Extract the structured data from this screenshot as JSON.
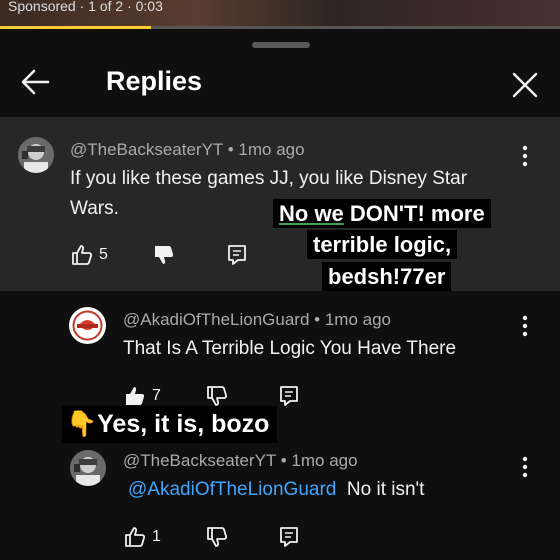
{
  "video": {
    "sponsor_text": "Sponsored · 1 of 2 · 0:03",
    "progress_fraction": 0.27,
    "progress_color": "#ffcc33"
  },
  "header": {
    "title": "Replies",
    "back_icon": "arrow-left-icon",
    "close_icon": "close-icon"
  },
  "parent_comment": {
    "author": "@TheBackseaterYT",
    "time": "1mo ago",
    "text_line1": "If you like these games JJ, you like Disney Star",
    "text_line2": "Wars.",
    "likes": "5"
  },
  "replies": [
    {
      "author": "@AkadiOfTheLionGuard",
      "time": "1mo ago",
      "text": "That Is A Terrible Logic You Have There",
      "likes": "7"
    },
    {
      "author": "@TheBackseaterYT",
      "time": "1mo ago",
      "mention": "@AkadiOfTheLionGuard",
      "text": "No it isn't",
      "likes": "1"
    }
  ],
  "overlays": {
    "caption1_line1_a": "No we",
    "caption1_line1_b": " DON'T! more",
    "caption1_line2": "terrible logic,",
    "caption1_line3": "bedsh!77er",
    "caption2_emoji": "👇",
    "caption2_text": "Yes, it is, bozo"
  },
  "separator": " • "
}
